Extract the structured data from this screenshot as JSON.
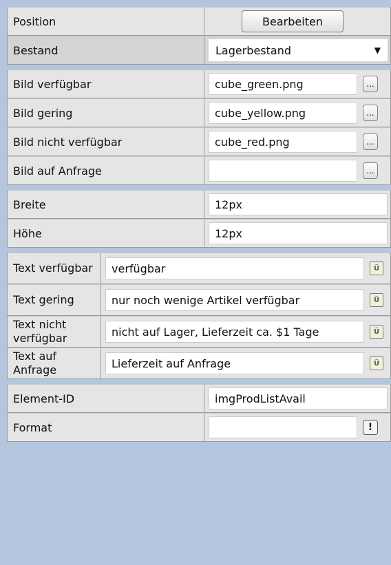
{
  "section1": {
    "position_label": "Position",
    "edit_button": "Bearbeiten",
    "bestand_label": "Bestand",
    "bestand_value": "Lagerbestand"
  },
  "images": [
    {
      "label": "Bild verfügbar",
      "value": "cube_green.png",
      "browse": "..."
    },
    {
      "label": "Bild gering",
      "value": "cube_yellow.png",
      "browse": "..."
    },
    {
      "label": "Bild nicht verfügbar",
      "value": "cube_red.png",
      "browse": "..."
    },
    {
      "label": "Bild auf Anfrage",
      "value": "",
      "browse": "..."
    }
  ],
  "size": {
    "width_label": "Breite",
    "width_value": "12px",
    "height_label": "Höhe",
    "height_value": "12px"
  },
  "texts": [
    {
      "label": "Text verfügbar",
      "value": "verfügbar"
    },
    {
      "label": "Text gering",
      "value": "nur noch wenige Artikel verfügbar"
    },
    {
      "label": "Text nicht verfügbar",
      "value": "nicht auf Lager, Lieferzeit ca. $1 Tage"
    },
    {
      "label": "Text auf Anfrage",
      "value": "Lieferzeit auf Anfrage"
    }
  ],
  "element": {
    "id_label": "Element-ID",
    "id_value": "imgProdListAvail",
    "format_label": "Format",
    "format_value": "",
    "format_button": "!"
  },
  "icons": {
    "dropdown": "chevron-down-icon",
    "dictionary": "dictionary-icon"
  }
}
